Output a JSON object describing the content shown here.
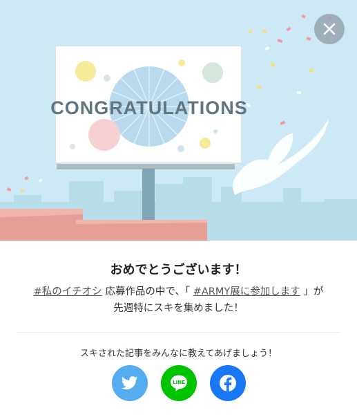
{
  "banner": {
    "sign_text": "CONGRATULATIONS"
  },
  "dialog": {
    "title": "おめでとうございます！",
    "tag_link": "#私のイチオシ",
    "text_mid": "応募作品の中で、「",
    "article_link": "#ARMY展に参加します",
    "text_end_1": "」が",
    "text_line2": "先週特にスキを集めました！",
    "share_prompt": "スキされた記事をみんなに教えてあげましょう！"
  },
  "share": {
    "twitter": "twitter-icon",
    "line": "line-icon",
    "line_label": "LINE",
    "facebook": "facebook-icon"
  },
  "colors": {
    "sky": "#cde9f6",
    "twitter": "#55acee",
    "line": "#00c300",
    "facebook": "#1877f2"
  }
}
